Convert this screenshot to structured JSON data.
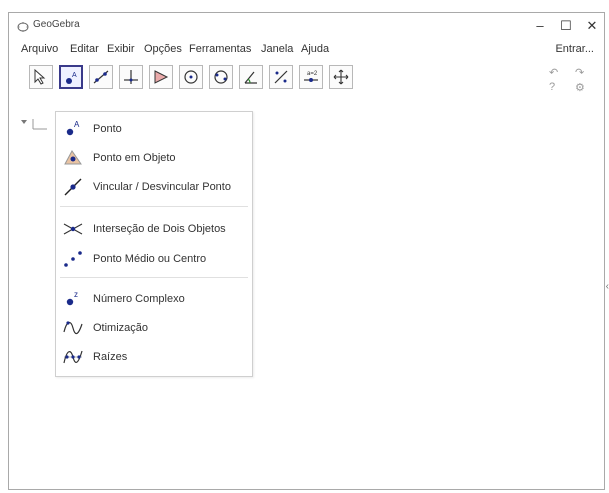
{
  "window": {
    "title": "GeoGebra",
    "controls": [
      "–",
      "☐",
      "✕"
    ]
  },
  "menu": {
    "items": [
      "Arquivo",
      "Editar",
      "Exibir",
      "Opções",
      "Ferramentas",
      "Janela",
      "Ajuda"
    ],
    "signin": "Entrar..."
  },
  "toolbar": {
    "tools": [
      "move-tool",
      "point-tool",
      "line-tool",
      "perpendicular-tool",
      "polygon-tool",
      "circle-tool",
      "conic-tool",
      "angle-tool",
      "reflect-tool",
      "slider-tool",
      "move-graphics-tool"
    ],
    "active": "point-tool"
  },
  "toolbar_right": {
    "undo": "↶",
    "redo": "↷",
    "help": "?",
    "settings": "⚙"
  },
  "dropdown": {
    "items": [
      {
        "label": "Ponto",
        "icon": "point-icon"
      },
      {
        "label": "Ponto em Objeto",
        "icon": "point-on-object-icon"
      },
      {
        "label": "Vincular / Desvincular Ponto",
        "icon": "attach-detach-point-icon"
      },
      {
        "label": "Interseção de Dois Objetos",
        "icon": "intersect-icon"
      },
      {
        "label": "Ponto Médio ou Centro",
        "icon": "midpoint-icon"
      },
      {
        "label": "Número Complexo",
        "icon": "complex-number-icon"
      },
      {
        "label": "Otimização",
        "icon": "optimization-icon"
      },
      {
        "label": "Raízes",
        "icon": "roots-icon"
      }
    ]
  },
  "colors": {
    "accent": "#3a3a8a",
    "point": "#1a2a8a",
    "border": "#a9a9a9"
  }
}
